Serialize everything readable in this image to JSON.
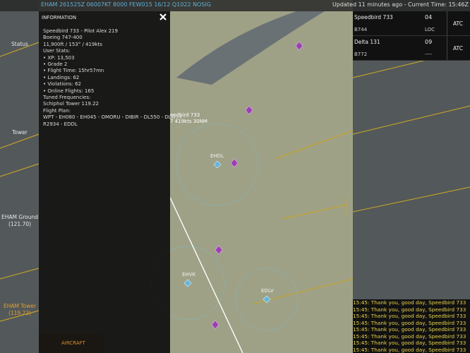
{
  "topbar": {
    "metar": "EHAM 261525Z 06007KT 8000 FEW015 16/12 Q1022 NOSIG",
    "updated": "Updated 11 minutes ago - Current Time: 15:46Z"
  },
  "nav": {
    "status": "Status",
    "tower": "Tower",
    "ground_name": "EHAM Ground",
    "ground_freq": "(121.70)",
    "tower_name": "EHAM Tower",
    "tower_freq": "(119.22)"
  },
  "panel": {
    "title": "INFORMATION",
    "close_icon": "close-icon",
    "lines": [
      "Speedbird 733 - Pilot Alex 219",
      "Boeing 747-400",
      "11,900ft / 153° / 419kts",
      "User Stats:",
      "• XP: 13,503",
      "• Grade 2",
      "• Flight Time: 15hr57mn",
      "• Landings: 62",
      "• Violations: 62",
      "• Online Flights: 165",
      "Tuned Frequencies:",
      "Schiphol Tower 119.22",
      "Flight Plan:",
      "WPT - EH080 - EH045 - OMORU - DIBIR - DL550 - DLW14 -",
      "R2934 - EDDL"
    ],
    "aircraft_tab": "AIRCRAFT"
  },
  "map": {
    "callout_1": "eedbird 733",
    "callout_2": "7 419kts 30NM",
    "airports": [
      "EHDL",
      "EHVK",
      "EDLV"
    ],
    "colors": {
      "airport": "#64b5d8",
      "waypoint": "#9a3fb0",
      "ring": "#7fb8c7"
    }
  },
  "strips": [
    {
      "callsign": "Speedbird 733",
      "type": "B744",
      "num": "04",
      "status": "LOC",
      "atc": "ATC"
    },
    {
      "callsign": "Delta 131",
      "type": "B772",
      "num": "09",
      "status": "----",
      "atc": "ATC"
    }
  ],
  "chat": {
    "messages": [
      "15:45: Thank you, good day, Speedbird 733",
      "15:45: Thank you, good day, Speedbird 733",
      "15:45: Thank you, good day, Speedbird 733",
      "15:45: Thank you, good day, Speedbird 733",
      "15:45: Thank you, good day, Speedbird 733",
      "15:45: Thank you, good day, Speedbird 733",
      "15:45: Thank you, good day, Speedbird 733",
      "15:45: Thank you, good day, Speedbird 733"
    ]
  }
}
